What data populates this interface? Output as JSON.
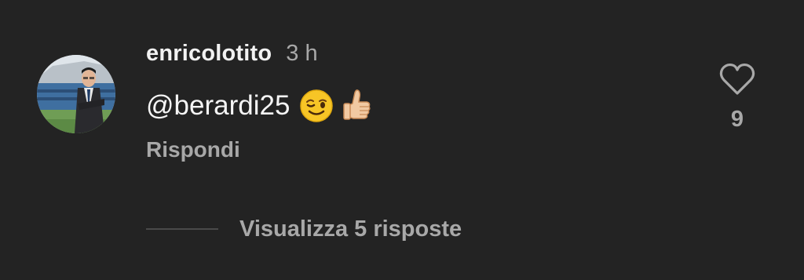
{
  "comment": {
    "username": "enricolotito",
    "time": "3 h",
    "text": "@berardi25",
    "emojis": [
      "winking-face-emoji",
      "thumbs-up-emoji"
    ],
    "reply_label": "Rispondi",
    "like_count": "9",
    "view_replies_label": "Visualizza 5 risposte"
  },
  "colors": {
    "background": "#232323",
    "primary_text": "#f5f5f5",
    "secondary_text": "#a8a8a8"
  }
}
